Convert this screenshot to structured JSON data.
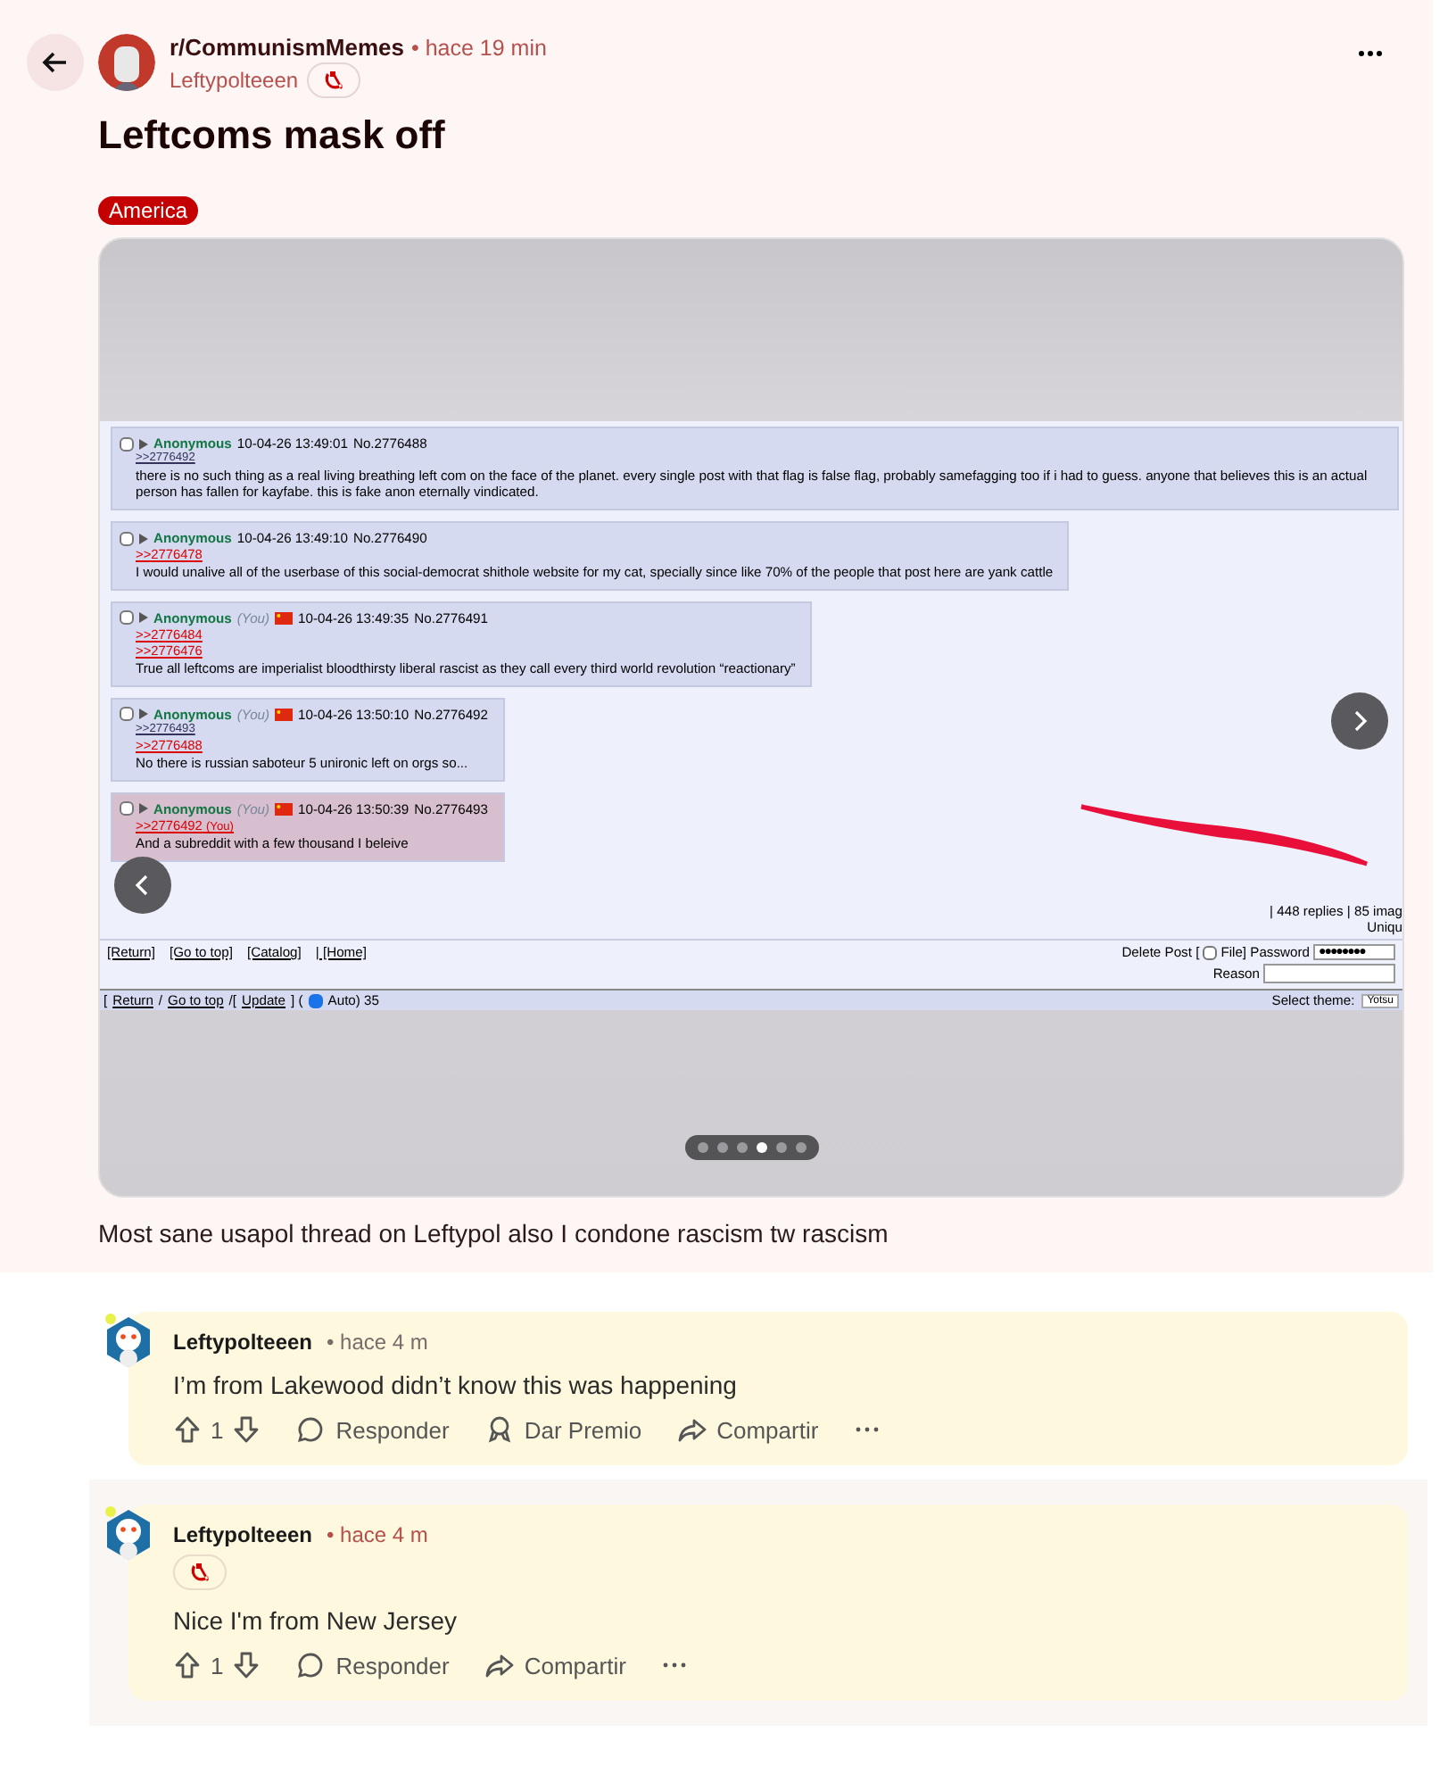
{
  "post": {
    "subreddit": "r/CommunismMemes",
    "time": "• hace 19 min",
    "author": "Leftypolteeen",
    "author_flair": true,
    "title": "Leftcoms mask off",
    "flair": "America",
    "carousel": {
      "board": {
        "posts": [
          {
            "name": "Anonymous",
            "checked": false,
            "flag": false,
            "datetime": "10-04-26 13:49:01",
            "number": "No.2776488",
            "highlighted": false,
            "links": [
              {
                "text": ">>2776492",
                "kind": "backlink"
              }
            ],
            "text": "there is no such thing as a real living breathing left com on the face of the planet. every single post with that flag is false flag, probably samefagging too if i had to guess. anyone that believes this is an actual person has fallen for kayfabe. this is fake anon eternally vindicated."
          },
          {
            "name": "Anonymous",
            "checked": false,
            "flag": false,
            "datetime": "10-04-26 13:49:10",
            "number": "No.2776490",
            "highlighted": false,
            "links": [
              {
                "text": ">>2776478",
                "kind": "quote"
              }
            ],
            "text": "I would unalive all of the userbase of this social-democrat shithole website for my cat, specially since like 70% of the people that post here are yank cattle"
          },
          {
            "name": "Anonymous",
            "checked": false,
            "you_label": "(You)",
            "flag": true,
            "datetime": "10-04-26 13:49:35",
            "number": "No.2776491",
            "highlighted": false,
            "links": [
              {
                "text": ">>2776484",
                "kind": "quote"
              },
              {
                "text": ">>2776476",
                "kind": "quote"
              }
            ],
            "text": "True all leftcoms are imperialist bloodthirsty liberal rascist as they call every third world revolution “reactionary”"
          },
          {
            "name": "Anonymous",
            "checked": false,
            "you_label": "(You)",
            "flag": true,
            "datetime": "10-04-26 13:50:10",
            "number": "No.2776492",
            "highlighted": false,
            "links": [
              {
                "text": ">>2776493",
                "kind": "backlink"
              },
              {
                "text": ">>2776488",
                "kind": "quote"
              }
            ],
            "text": "No there is russian saboteur 5 unironic left on orgs so..."
          },
          {
            "name": "Anonymous",
            "checked": false,
            "you_label": "(You)",
            "flag": true,
            "datetime": "10-04-26 13:50:39",
            "number": "No.2776493",
            "highlighted": true,
            "links": [
              {
                "text": ">>2776492",
                "kind": "quote",
                "tag": "(You)"
              }
            ],
            "text": "And a subreddit with a few thousand I beleive"
          }
        ],
        "stats": "| 448 replies | 85 imag",
        "stats_2": "Uniqu",
        "nav_links": [
          "[Return]",
          "[Go to top]",
          "[Catalog]",
          "| [Home]"
        ],
        "delete_label": "Delete Post [",
        "file_checked": false,
        "file_label": "File] Password",
        "password": "●●●●●●●●",
        "reason_label": "Reason",
        "bottom_bar": [
          {
            "kind": "text",
            "text": "["
          },
          {
            "kind": "link",
            "text": "Return"
          },
          {
            "kind": "text",
            "text": "/"
          },
          {
            "kind": "link",
            "text": "Go to top"
          },
          {
            "kind": "text",
            "text": "/["
          },
          {
            "kind": "link",
            "text": "Update"
          },
          {
            "kind": "text",
            "text": "] ("
          },
          {
            "kind": "checkbox",
            "checked": true
          },
          {
            "kind": "text",
            "text": "Auto) 35"
          }
        ],
        "theme_label": "Select theme:",
        "theme_value": "Yotsu"
      },
      "dots": [
        {
          "selected": false
        },
        {
          "selected": false
        },
        {
          "selected": false
        },
        {
          "selected": true
        },
        {
          "selected": false
        },
        {
          "selected": false
        }
      ]
    },
    "body": "Most sane usapol thread on Leftypol also I condone rascism tw rascism"
  },
  "comments": [
    {
      "author": "Leftypolteeen",
      "time": "• hace 4 m",
      "flair": false,
      "shaded": false,
      "text": "I’m from Lakewood didn’t know this was happening",
      "votes": "1",
      "actions": [
        {
          "kind": "reply",
          "label": "Responder"
        },
        {
          "kind": "award",
          "label": "Dar Premio"
        },
        {
          "kind": "share",
          "label": "Compartir"
        }
      ]
    },
    {
      "author": "Leftypolteeen",
      "time": "• hace 4 m",
      "flair": true,
      "shaded": true,
      "text": "Nice I'm from New Jersey",
      "votes": "1",
      "actions": [
        {
          "kind": "reply",
          "label": "Responder"
        },
        {
          "kind": "share",
          "label": "Compartir"
        }
      ]
    }
  ]
}
